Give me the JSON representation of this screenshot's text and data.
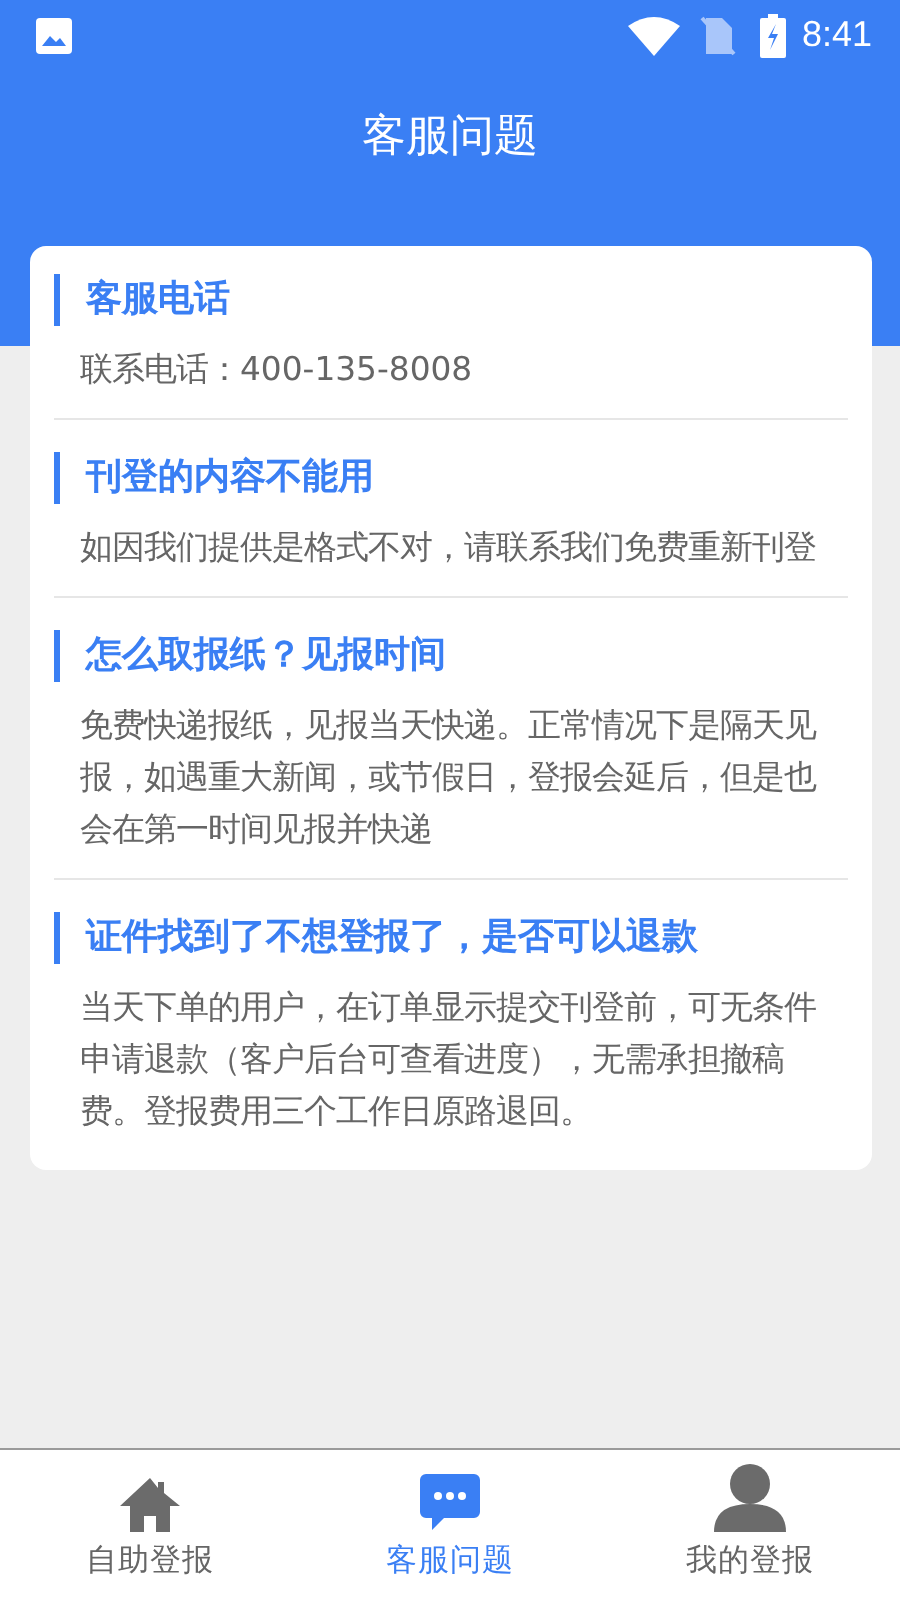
{
  "status_bar": {
    "time": "8:41"
  },
  "header": {
    "title": "客服问题"
  },
  "faq": [
    {
      "title": "客服电话",
      "body": "联系电话：400-135-8008"
    },
    {
      "title": "刊登的内容不能用",
      "body": "如因我们提供是格式不对，请联系我们免费重新刊登"
    },
    {
      "title": "怎么取报纸？见报时间",
      "body": "免费快递报纸，见报当天快递。正常情况下是隔天见报，如遇重大新闻，或节假日，登报会延后，但是也会在第一时间见报并快递"
    },
    {
      "title": "证件找到了不想登报了，是否可以退款",
      "body": "当天下单的用户，在订单显示提交刊登前，可无条件申请退款（客户后台可查看进度），无需承担撤稿费。登报费用三个工作日原路退回。"
    }
  ],
  "tab_bar": [
    {
      "kind": "home",
      "label": "自助登报",
      "selected": false
    },
    {
      "kind": "chat",
      "label": "客服问题",
      "selected": true
    },
    {
      "kind": "person",
      "label": "我的登报",
      "selected": false
    }
  ]
}
